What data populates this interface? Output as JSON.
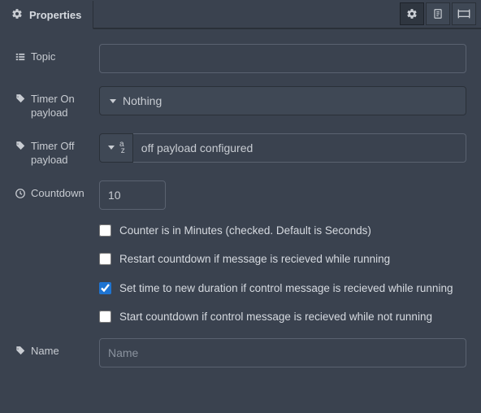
{
  "tab": {
    "title": "Properties"
  },
  "labels": {
    "topic": "Topic",
    "timer_on": "Timer On payload",
    "timer_off": "Timer Off payload",
    "countdown": "Countdown",
    "name": "Name"
  },
  "fields": {
    "topic_value": "",
    "timer_on_type": "Nothing",
    "timer_off_value": "off payload configured",
    "countdown_value": "10",
    "name_value": "",
    "name_placeholder": "Name"
  },
  "checkboxes": {
    "minutes": {
      "label": "Counter is in Minutes (checked. Default is Seconds)",
      "checked": false
    },
    "restart": {
      "label": "Restart countdown if message is recieved while running",
      "checked": false
    },
    "settime": {
      "label": "Set time to new duration if control message is recieved while running",
      "checked": true
    },
    "startif": {
      "label": "Start countdown if control message is recieved while not running",
      "checked": false
    }
  }
}
